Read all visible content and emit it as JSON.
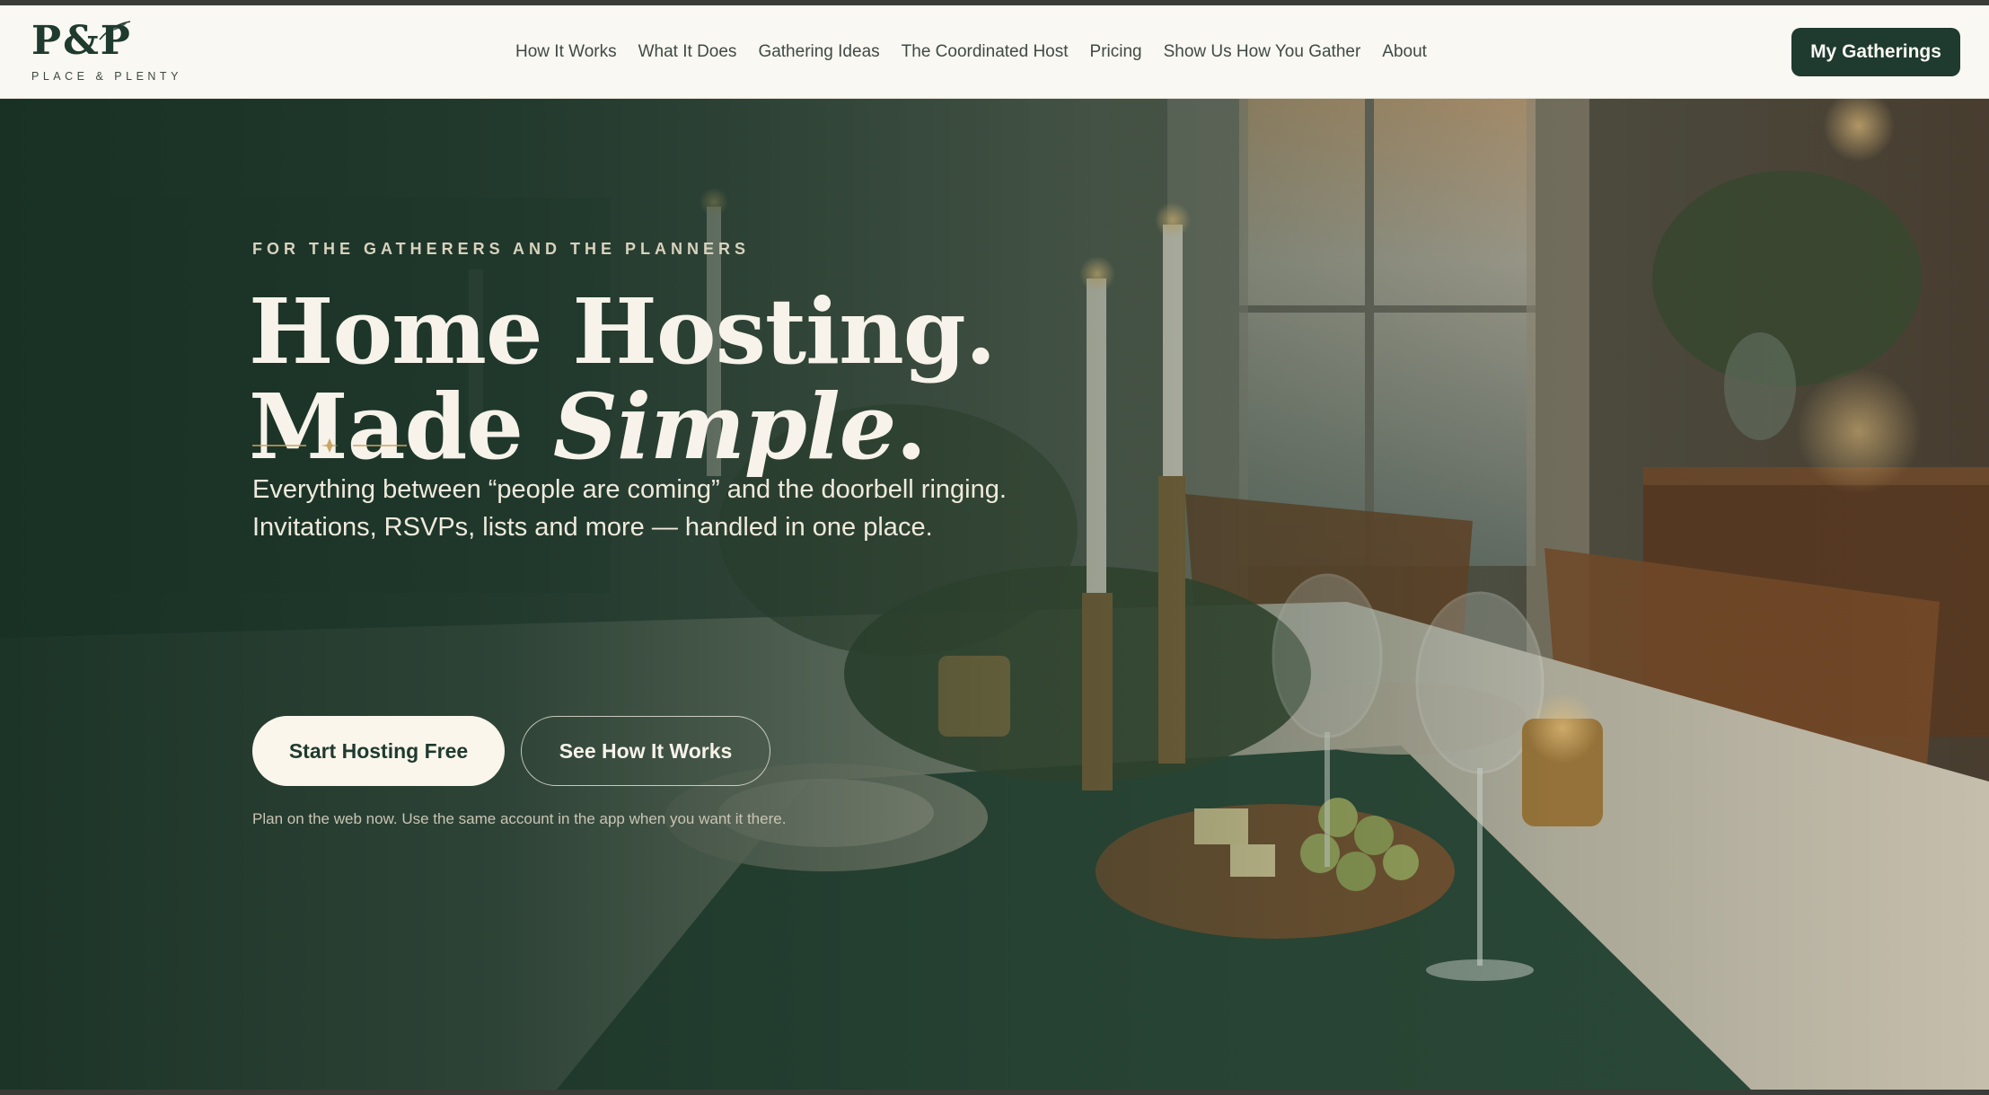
{
  "header": {
    "logo_mark": "P&P",
    "logo_subtitle": "PLACE & PLENTY",
    "nav": [
      {
        "label": "How It Works"
      },
      {
        "label": "What It Does"
      },
      {
        "label": "Gathering Ideas"
      },
      {
        "label": "The Coordinated Host"
      },
      {
        "label": "Pricing"
      },
      {
        "label": "Show Us How You Gather"
      },
      {
        "label": "About"
      }
    ],
    "cta_label": "My Gatherings"
  },
  "hero": {
    "eyebrow": "FOR THE GATHERERS AND THE PLANNERS",
    "headline_line1": "Home Hosting.",
    "headline_line2_prefix": "Made ",
    "headline_line2_emphasis": "Simple",
    "headline_line2_suffix": ".",
    "subcopy_line1": "Everything between “people are coming” and the doorbell ringing.",
    "subcopy_line2": "Invitations, RSVPs, lists and more — handled in one place.",
    "primary_button": "Start Hosting Free",
    "secondary_button": "See How It Works",
    "note": "Plan on the web now. Use the same account in the app when you want it there.",
    "background_image": "candlelit-dinner-table-photo"
  },
  "colors": {
    "brand_green": "#1f3a2e",
    "cream": "#faf8f2",
    "gold_accent": "#c9a463"
  }
}
